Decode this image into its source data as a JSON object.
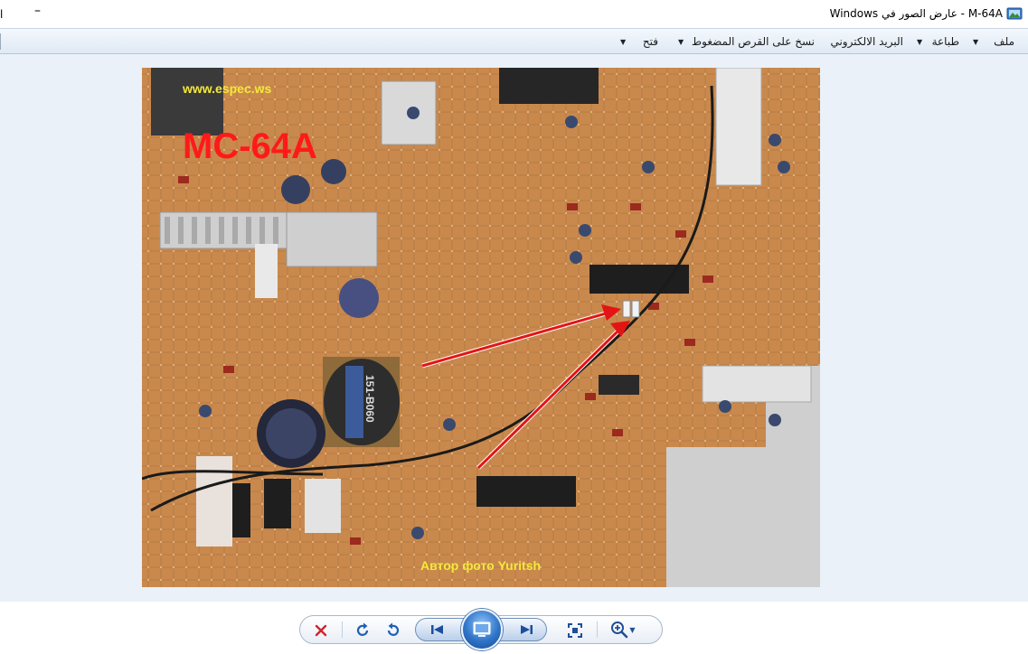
{
  "window": {
    "title": "M-64A - عارض الصور في Windows",
    "left_mark": "l",
    "app_icon": "photo-viewer-icon"
  },
  "menu": {
    "items": [
      {
        "label": "ملف",
        "has_dropdown": true
      },
      {
        "label": "طباعة",
        "has_dropdown": true
      },
      {
        "label": "البريد الالكتروني",
        "has_dropdown": false
      },
      {
        "label": "نسخ على القرص المضغوط",
        "has_dropdown": false
      },
      {
        "label": "فتح",
        "has_dropdown": true
      }
    ]
  },
  "photo": {
    "watermark_top": "www.espec.ws",
    "model_label": "MC-64A",
    "credit": "Автор фото Yuritsh",
    "chip_label": "151-B060"
  },
  "controls": {
    "delete_icon": "delete-icon",
    "rotate_cw_icon": "rotate-clockwise-icon",
    "rotate_ccw_icon": "rotate-counterclockwise-icon",
    "previous_icon": "previous-icon",
    "slideshow_icon": "slideshow-icon",
    "next_icon": "next-icon",
    "actual_size_icon": "actual-size-icon",
    "zoom_icon": "zoom-icon"
  },
  "colors": {
    "viewer_bg": "#eaf1f9",
    "pcb": "#c8884c",
    "label_red": "#ff1a1a",
    "label_yellow": "#f4e83a",
    "arrow_red": "#e41414"
  }
}
